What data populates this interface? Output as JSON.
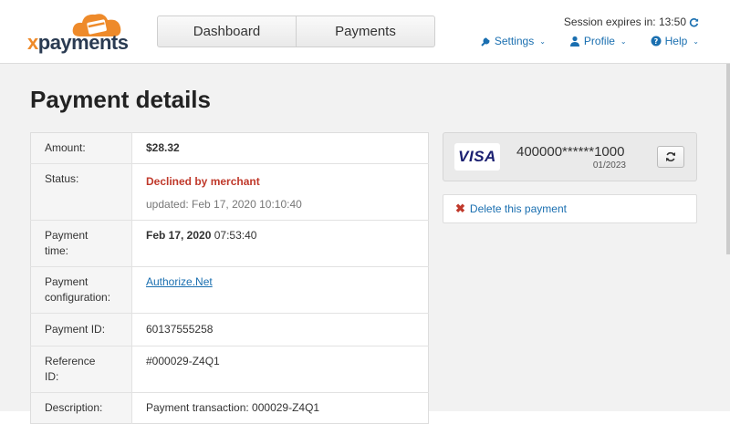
{
  "app": {
    "logo_x": "x",
    "logo_rest": "payments"
  },
  "nav": {
    "tabs": [
      {
        "label": "Dashboard"
      },
      {
        "label": "Payments"
      }
    ]
  },
  "session": {
    "text": "Session expires in: 13:50"
  },
  "menu": {
    "settings": "Settings",
    "profile": "Profile",
    "help": "Help"
  },
  "page": {
    "title": "Payment details"
  },
  "details": {
    "amount_label": "Amount:",
    "amount_value": "$28.32",
    "status_label": "Status:",
    "status_value": "Declined by merchant",
    "status_updated": "updated: Feb 17, 2020 10:10:40",
    "time_label_1": "Payment",
    "time_label_2": "time:",
    "time_date": "Feb 17, 2020",
    "time_clock": "07:53:40",
    "config_label_1": "Payment",
    "config_label_2": "configuration:",
    "config_value": "Authorize.Net",
    "id_label": "Payment ID:",
    "id_value": "60137555258",
    "ref_label_1": "Reference",
    "ref_label_2": "ID:",
    "ref_value": "#000029-Z4Q1",
    "desc_label": "Description:",
    "desc_value": "Payment transaction: 000029-Z4Q1"
  },
  "card": {
    "brand": "VISA",
    "number": "400000******1000",
    "expiry": "01/2023"
  },
  "actions": {
    "delete_label": "Delete this payment"
  },
  "colors": {
    "accent": "#1a6fb0",
    "brand_orange": "#ee8a2a",
    "declined": "#c0392b"
  }
}
